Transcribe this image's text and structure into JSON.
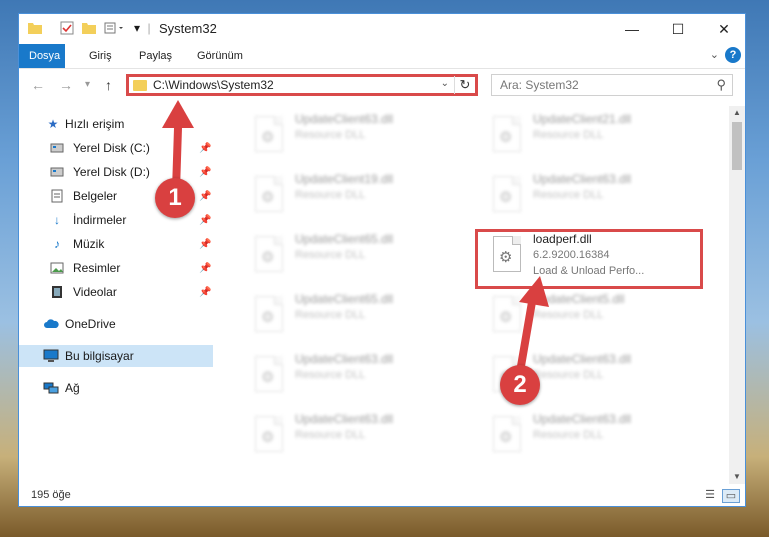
{
  "window": {
    "title": "System32",
    "controls": {
      "minimize": "—",
      "maximize": "☐",
      "close": "✕"
    }
  },
  "quick_access_icons": [
    "folder-icon",
    "properties-checkbox-icon",
    "new-folder-icon",
    "customize-icon"
  ],
  "ribbon": {
    "tabs": [
      "Dosya",
      "Giriş",
      "Paylaş",
      "Görünüm"
    ],
    "active_tab": "Dosya",
    "help_label": "?"
  },
  "navigation": {
    "address": "C:\\Windows\\System32",
    "search_placeholder": "Ara: System32"
  },
  "sidebar": {
    "items": [
      {
        "label": "Hızlı erişim",
        "icon": "star-icon"
      },
      {
        "label": "Yerel Disk (C:)",
        "icon": "drive-icon",
        "pinned": true
      },
      {
        "label": "Yerel Disk (D:)",
        "icon": "drive-icon",
        "pinned": true
      },
      {
        "label": "Belgeler",
        "icon": "documents-icon",
        "pinned": true
      },
      {
        "label": "İndirmeler",
        "icon": "download-icon",
        "pinned": true
      },
      {
        "label": "Müzik",
        "icon": "music-icon",
        "pinned": true
      },
      {
        "label": "Resimler",
        "icon": "pictures-icon",
        "pinned": true
      },
      {
        "label": "Videolar",
        "icon": "video-icon",
        "pinned": true
      },
      {
        "label": "OneDrive",
        "icon": "cloud-icon"
      },
      {
        "label": "Bu bilgisayar",
        "icon": "computer-icon",
        "selected": true
      },
      {
        "label": "Ağ",
        "icon": "network-icon"
      }
    ]
  },
  "files": [
    {
      "name": "UpdateClient63.dll",
      "type": "Resource DLL",
      "blurred": true
    },
    {
      "name": "UpdateClient21.dll",
      "type": "Resource DLL",
      "blurred": true
    },
    {
      "name": "UpdateClient19.dll",
      "type": "Resource DLL",
      "blurred": true
    },
    {
      "name": "UpdateClient63.dll",
      "type": "Resource DLL",
      "blurred": true
    },
    {
      "name": "UpdateClient65.dll",
      "type": "Resource DLL",
      "blurred": true
    },
    {
      "name": "loadperf.dll",
      "version": "6.2.9200.16384",
      "description": "Load & Unload Perfo...",
      "blurred": false
    },
    {
      "name": "UpdateClient65.dll",
      "type": "Resource DLL",
      "blurred": true
    },
    {
      "name": "UpdateClient5.dll",
      "type": "Resource DLL",
      "blurred": true
    },
    {
      "name": "UpdateClient63.dll",
      "type": "Resource DLL",
      "blurred": true
    },
    {
      "name": "UpdateClient63.dll",
      "type": "Resource DLL",
      "blurred": true
    },
    {
      "name": "UpdateClient63.dll",
      "type": "Resource DLL",
      "blurred": true
    },
    {
      "name": "UpdateClient63.dll",
      "type": "Resource DLL",
      "blurred": true
    }
  ],
  "annotations": {
    "step1": "1",
    "step2": "2",
    "color": "#d94040"
  },
  "status": {
    "item_count": "195 öğe"
  }
}
